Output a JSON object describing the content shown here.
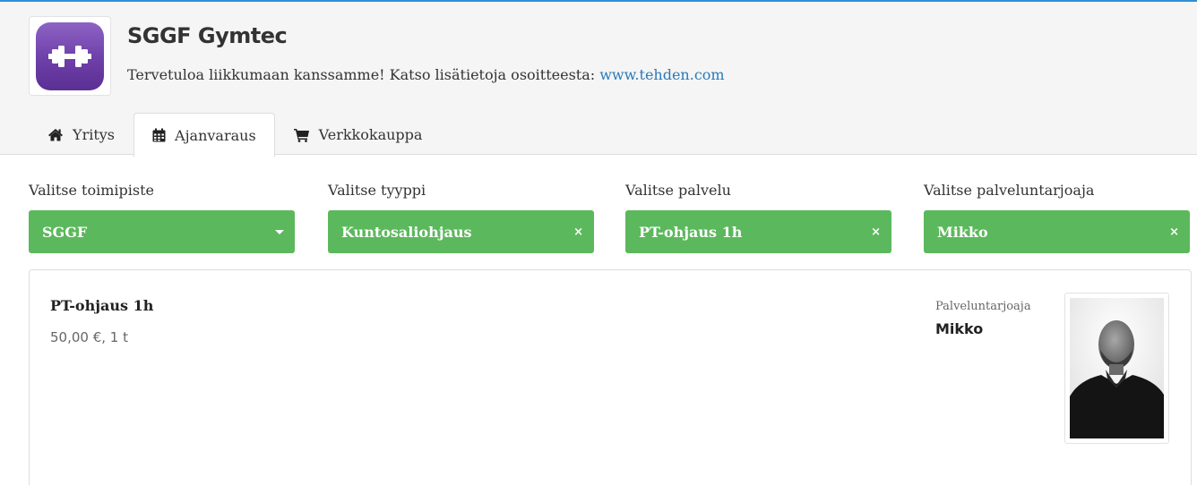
{
  "company": {
    "name": "SGGF Gymtec",
    "welcome_text": "Tervetuloa liikkumaan kanssamme! Katso lisätietoja osoitteesta: ",
    "website": "www.tehden.com",
    "logo_icon": "dumbbell-icon"
  },
  "tabs": [
    {
      "label": "Yritys",
      "icon": "home-icon",
      "active": false
    },
    {
      "label": "Ajanvaraus",
      "icon": "calendar-icon",
      "active": true
    },
    {
      "label": "Verkkokauppa",
      "icon": "cart-icon",
      "active": false
    }
  ],
  "filters": [
    {
      "label": "Valitse toimipiste",
      "value": "SGGF",
      "control": "dropdown"
    },
    {
      "label": "Valitse tyyppi",
      "value": "Kuntosaliohjaus",
      "control": "clear"
    },
    {
      "label": "Valitse palvelu",
      "value": "PT-ohjaus 1h",
      "control": "clear"
    },
    {
      "label": "Valitse palveluntarjoaja",
      "value": "Mikko",
      "control": "clear"
    }
  ],
  "card": {
    "service_name": "PT-ohjaus 1h",
    "price": "50,00 €,  1 t",
    "provider_label": "Palveluntarjoaja",
    "provider_name": "Mikko"
  },
  "colors": {
    "accent_green": "#5cb85c",
    "link_blue": "#2a7ab8",
    "top_line": "#2f8fd8",
    "logo_purple": "#6d3fa8"
  }
}
